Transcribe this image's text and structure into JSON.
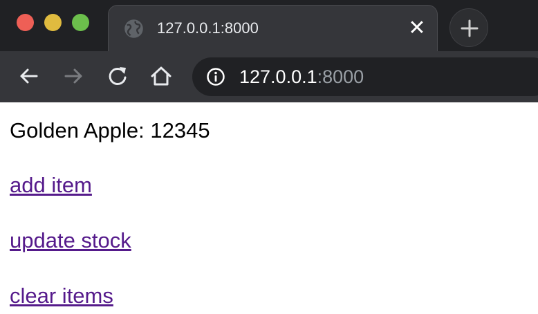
{
  "browser": {
    "tab": {
      "title": "127.0.0.1:8000",
      "close_glyph": "✕",
      "favicon": "globe-icon"
    },
    "address_bar": {
      "host": "127.0.0.1",
      "port": ":8000",
      "security_icon": "info-icon"
    },
    "nav": [
      "back-arrow-icon",
      "forward-arrow-icon",
      "reload-icon",
      "home-icon"
    ],
    "colors": {
      "chrome_dark": "#202124",
      "chrome_light": "#35363a",
      "traffic_red": "#ee5f56",
      "traffic_yellow": "#e0bb3f",
      "traffic_green": "#6cbf4c"
    }
  },
  "page": {
    "product": {
      "name": "Golden Apple",
      "separator": ": ",
      "stock": "12345"
    },
    "links": {
      "add": "add item",
      "update": "update stock",
      "clear": "clear items"
    },
    "colors": {
      "link": "#551a8b",
      "text": "#000000"
    }
  }
}
